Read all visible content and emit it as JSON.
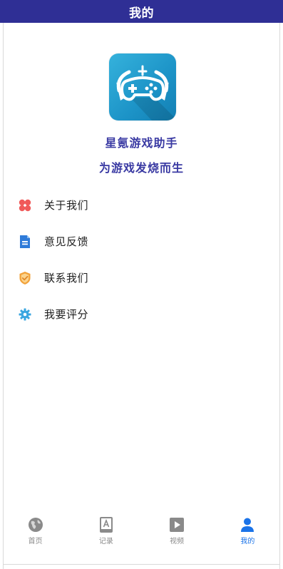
{
  "header": {
    "title": "我的"
  },
  "profile": {
    "app_name": "星氪游戏助手",
    "slogan": "为游戏发烧而生",
    "logo_icon": "gamepad-icon"
  },
  "menu": {
    "items": [
      {
        "label": "关于我们",
        "icon": "clover-icon",
        "color": "#f05a5a"
      },
      {
        "label": "意见反馈",
        "icon": "document-icon",
        "color": "#2f7bd9"
      },
      {
        "label": "联系我们",
        "icon": "shield-check-icon",
        "color": "#f2a23a"
      },
      {
        "label": "我要评分",
        "icon": "gear-icon",
        "color": "#3aa6e0"
      }
    ]
  },
  "tabbar": {
    "active_color": "#1a73e8",
    "inactive_color": "#8a8a8a",
    "tabs": [
      {
        "label": "首页",
        "icon": "globe-icon",
        "active": false
      },
      {
        "label": "记录",
        "icon": "book-icon",
        "active": false
      },
      {
        "label": "视频",
        "icon": "play-icon",
        "active": false
      },
      {
        "label": "我的",
        "icon": "person-icon",
        "active": true
      }
    ]
  },
  "colors": {
    "header_bg": "#2f2f95",
    "brand_text": "#3a3aa3",
    "logo_blue": "#1c93c7"
  }
}
